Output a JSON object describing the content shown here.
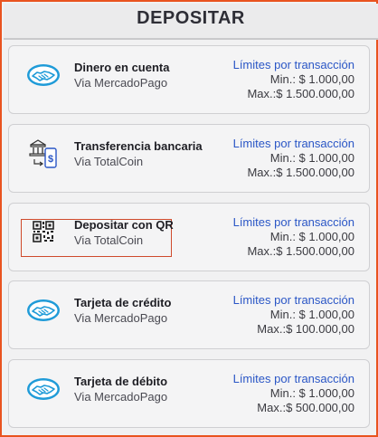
{
  "header": {
    "title": "DEPOSITAR"
  },
  "methods": [
    {
      "name": "Dinero en cuenta",
      "provider": "Via MercadoPago",
      "icon": "handshake-icon",
      "limits_title": "Límites por transacción",
      "min": "Min.: $ 1.000,00",
      "max": "Max.:$ 1.500.000,00"
    },
    {
      "name": "Transferencia bancaria",
      "provider": "Via TotalCoin",
      "icon": "bank-transfer-icon",
      "limits_title": "Límites por transacción",
      "min": "Min.: $ 1.000,00",
      "max": "Max.:$ 1.500.000,00"
    },
    {
      "name": "Depositar con QR",
      "provider": "Via TotalCoin",
      "icon": "qr-code-icon",
      "limits_title": "Límites por transacción",
      "min": "Min.: $ 1.000,00",
      "max": "Max.:$ 1.500.000,00"
    },
    {
      "name": "Tarjeta de crédito",
      "provider": "Via MercadoPago",
      "icon": "handshake-icon",
      "limits_title": "Límites por transacción",
      "min": "Min.: $ 1.000,00",
      "max": "Max.:$ 100.000,00"
    },
    {
      "name": "Tarjeta de débito",
      "provider": "Via MercadoPago",
      "icon": "handshake-icon",
      "limits_title": "Límites por transacción",
      "min": "Min.: $ 1.000,00",
      "max": "Max.:$ 500.000,00"
    }
  ],
  "colors": {
    "frame_border": "#e9531f",
    "limits_title": "#2a56c6",
    "mercadopago_blue": "#1f9bd8",
    "highlight_border": "#cf4a2c"
  }
}
